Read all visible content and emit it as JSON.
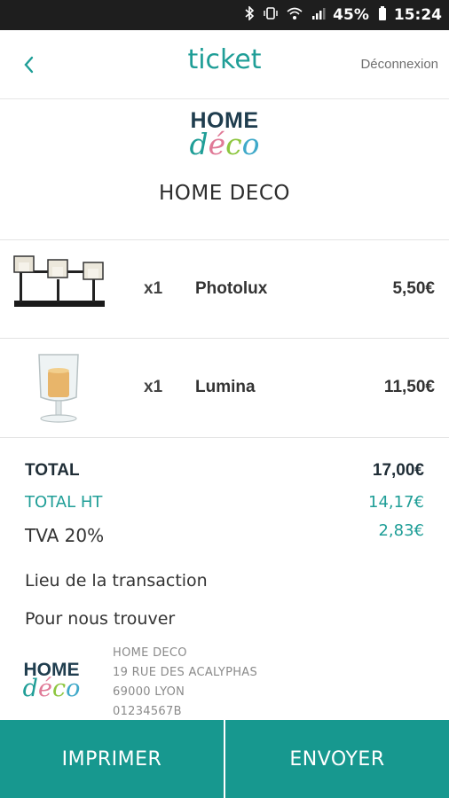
{
  "status_bar": {
    "battery": "45%",
    "time": "15:24",
    "icons": [
      "bluetooth-icon",
      "vibrate-icon",
      "wifi-icon",
      "signal-icon",
      "battery-icon"
    ]
  },
  "header": {
    "title": "ticket",
    "logout": "Déconnexion",
    "back_icon": "chevron-left-icon"
  },
  "brand": {
    "logo_home": "HOME",
    "logo_deco_letters": [
      "d",
      "é",
      "c",
      "o"
    ],
    "logo_deco_colors": [
      "#1f9e97",
      "#e07a97",
      "#8dc63f",
      "#3fa9c9"
    ],
    "store_name": "HOME DECO"
  },
  "items": [
    {
      "qty": "x1",
      "name": "Photolux",
      "price": "5,50€",
      "image": "candle-holder-three-image"
    },
    {
      "qty": "x1",
      "name": "Lumina",
      "price": "11,50€",
      "image": "glass-candle-image"
    }
  ],
  "totals": {
    "total_label": "TOTAL",
    "total_value": "17,00€",
    "ht_label": "TOTAL HT",
    "ht_value": "14,17€",
    "tva_label": "TVA 20%",
    "tva_value": "2,83€"
  },
  "location": {
    "transaction_label": "Lieu de la transaction",
    "find_us_label": "Pour nous trouver",
    "address_lines": [
      "HOME DECO",
      "19 RUE DES ACALYPHAS",
      "69000 LYON",
      "01234567B"
    ]
  },
  "actions": {
    "print": "IMPRIMER",
    "send": "ENVOYER"
  },
  "colors": {
    "accent": "#1f9e97",
    "button": "#17988f",
    "status_bar": "#1e1e1e"
  }
}
